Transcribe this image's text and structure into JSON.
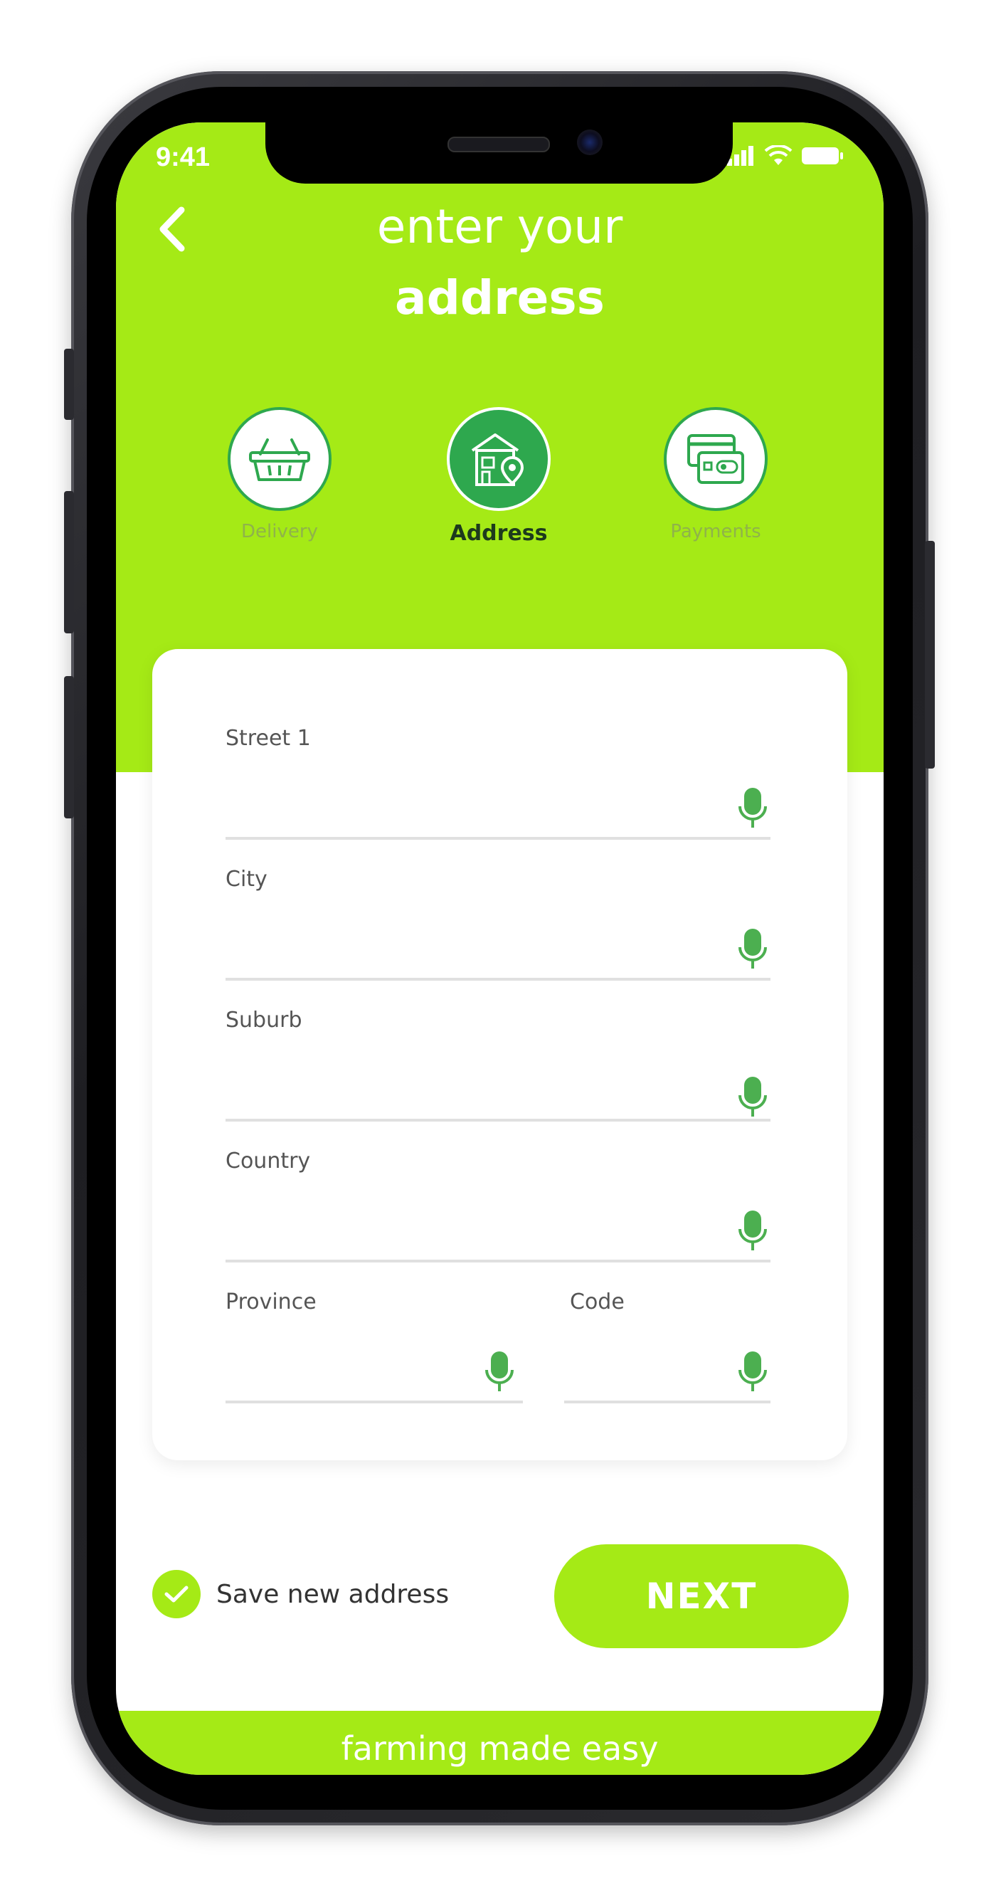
{
  "status_bar": {
    "time": "9:41"
  },
  "header": {
    "title_line1": "enter your",
    "title_line2": "address",
    "back_icon": "chevron-left-icon"
  },
  "steps": [
    {
      "label": "Delivery",
      "icon": "basket-icon",
      "active": false
    },
    {
      "label": "Address",
      "icon": "house-location-icon",
      "active": true
    },
    {
      "label": "Payments",
      "icon": "payment-card-icon",
      "active": false
    }
  ],
  "form": {
    "fields": [
      {
        "label": "Street 1",
        "value": ""
      },
      {
        "label": "City",
        "value": ""
      },
      {
        "label": "Suburb",
        "value": ""
      },
      {
        "label": "Country",
        "value": ""
      },
      {
        "label": "Province",
        "value": ""
      },
      {
        "label": "Code",
        "value": ""
      }
    ]
  },
  "save_address": {
    "label": "Save new address",
    "checked": true
  },
  "next_button": {
    "label": "NEXT"
  },
  "footer": {
    "text": "farming made easy"
  },
  "colors": {
    "brand_green": "#a5ea16",
    "dark_green": "#2ea84e",
    "mic_green": "#4caf50"
  }
}
